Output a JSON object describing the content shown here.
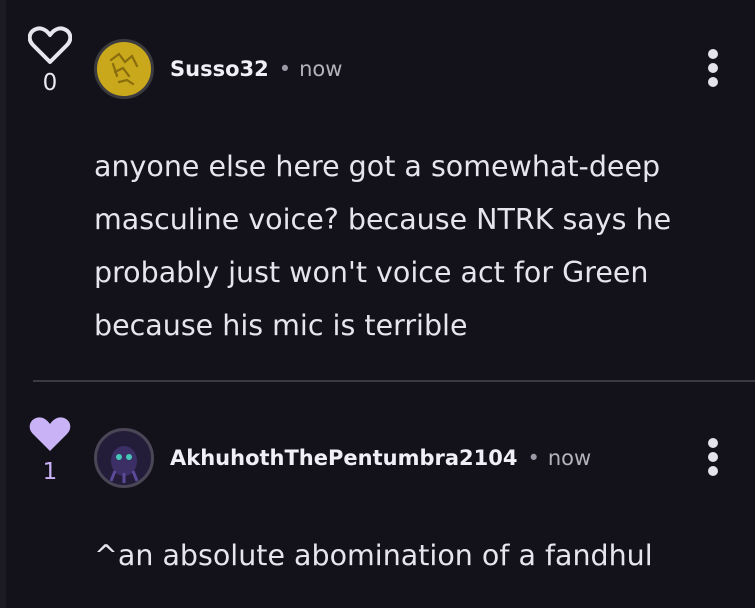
{
  "comments": [
    {
      "username": "Susso32",
      "separator": "•",
      "time": "now",
      "like_count": "0",
      "liked": false,
      "text": "anyone else here got a somewhat-deep masculine voice? because NTRK says he probably just won't voice act for Green because his mic is terrible",
      "avatar_color": "#c9a81c"
    },
    {
      "username": "AkhuhothThePentumbra2104",
      "separator": "•",
      "time": "now",
      "like_count": "1",
      "liked": true,
      "text": "^an absolute abomination of a fandhul",
      "avatar_color": "#3a2f5c"
    }
  ],
  "colors": {
    "like_active": "#c9b2f5",
    "background": "#13121a"
  },
  "icons": {
    "like": "heart-icon",
    "more": "more-options-icon"
  }
}
